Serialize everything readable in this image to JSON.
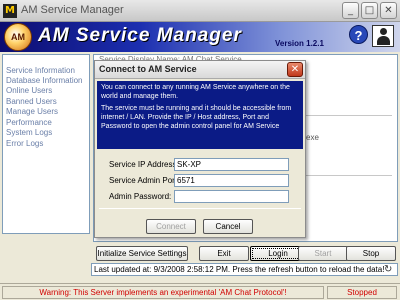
{
  "window": {
    "title": "AM Service Manager",
    "icon_text": "M",
    "controls": {
      "minimize": "_",
      "maximize": "□",
      "close": "✕"
    }
  },
  "header": {
    "title": "AM Service Manager",
    "version": "Version 1.2.1",
    "help_icon_glyph": "?"
  },
  "sidebar": {
    "items": [
      {
        "label": "Service Information"
      },
      {
        "label": "Database Information"
      },
      {
        "label": "Online Users"
      },
      {
        "label": "Banned Users"
      },
      {
        "label": "Manage Users"
      },
      {
        "label": "Performance"
      },
      {
        "label": "System Logs"
      },
      {
        "label": "Error Logs"
      }
    ]
  },
  "content": {
    "partial_line": "Service Display Name: AM Chat Service",
    "partial_text": "exe"
  },
  "buttons": {
    "initialize": "Initialize Service Settings",
    "exit": "Exit",
    "login": "Login",
    "start": "Start",
    "stop": "Stop"
  },
  "status": {
    "last_updated": "Last updated at: 9/3/2008 2:58:12 PM. Press the refresh button to reload the data!",
    "refresh_icon": "↻"
  },
  "footer": {
    "warning": "Warning: This Server implements an experimental 'AM Chat Protocol'!",
    "state": "Stopped"
  },
  "dialog": {
    "title": "Connect to AM Service",
    "info_1": "You can connect to any running AM Service anywhere on the world and manage them.",
    "info_2": "The service must be running and it should be accessible from internet / LAN. Provide the IP / Host address, Port and Password to open the admin control panel for AM Service",
    "fields": {
      "ip_label": "Service IP Address",
      "ip_value": "SK-XP",
      "port_label": "Service Admin Port",
      "port_value": "6571",
      "password_label": "Admin Password:",
      "password_value": ""
    },
    "connect_label": "Connect",
    "cancel_label": "Cancel"
  },
  "colors": {
    "header_gradient_start": "#0c0c70",
    "dialog_info_bg": "#0b1b86",
    "warning_text": "#d10000"
  }
}
